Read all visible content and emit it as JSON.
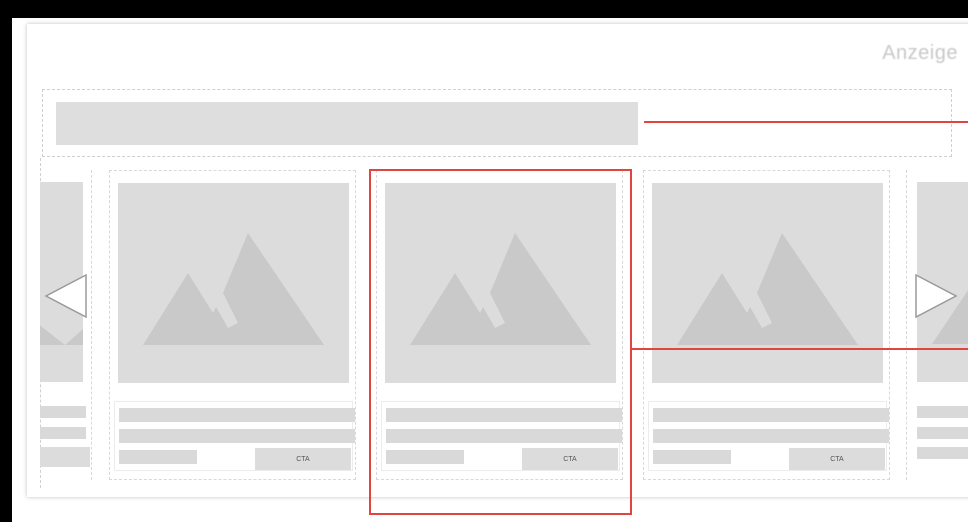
{
  "ad": {
    "label": "Anzeige"
  },
  "carousel": {
    "cards": [
      {
        "cta_label": "CTA"
      },
      {
        "cta_label": "CTA"
      },
      {
        "cta_label": "CTA"
      }
    ]
  },
  "colors": {
    "placeholder": "#dcdcdc",
    "highlight": "#e0463f"
  },
  "icons": {
    "prev": "chevron-left-outline",
    "next": "chevron-right-outline",
    "image": "mountain-image-placeholder"
  }
}
